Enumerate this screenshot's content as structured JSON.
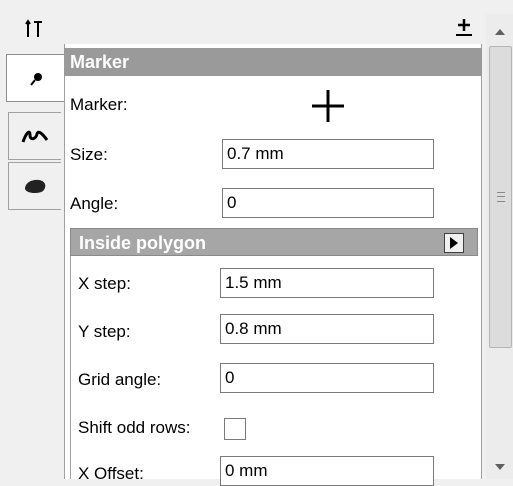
{
  "marker_section": {
    "title": "Marker",
    "marker_label": "Marker:",
    "size_label": "Size:",
    "size_value": "0.7 mm",
    "angle_label": "Angle:",
    "angle_value": "0"
  },
  "inside_polygon": {
    "title": "Inside polygon",
    "x_step_label": "X step:",
    "x_step_value": "1.5 mm",
    "y_step_label": "Y step:",
    "y_step_value": "0.8 mm",
    "grid_angle_label": "Grid angle:",
    "grid_angle_value": "0",
    "shift_odd_rows_label": "Shift odd rows:",
    "shift_odd_rows_checked": false,
    "x_offset_label": "X Offset:",
    "x_offset_value": "0 mm"
  },
  "icons": {
    "tabs": [
      "align-tools-icon",
      "marker-icon",
      "line-icon",
      "polygon-icon"
    ],
    "add": "plus-icon",
    "expand": "triangle-right-icon",
    "scroll_up": "chevron-up-icon",
    "scroll_down": "chevron-down-icon"
  }
}
